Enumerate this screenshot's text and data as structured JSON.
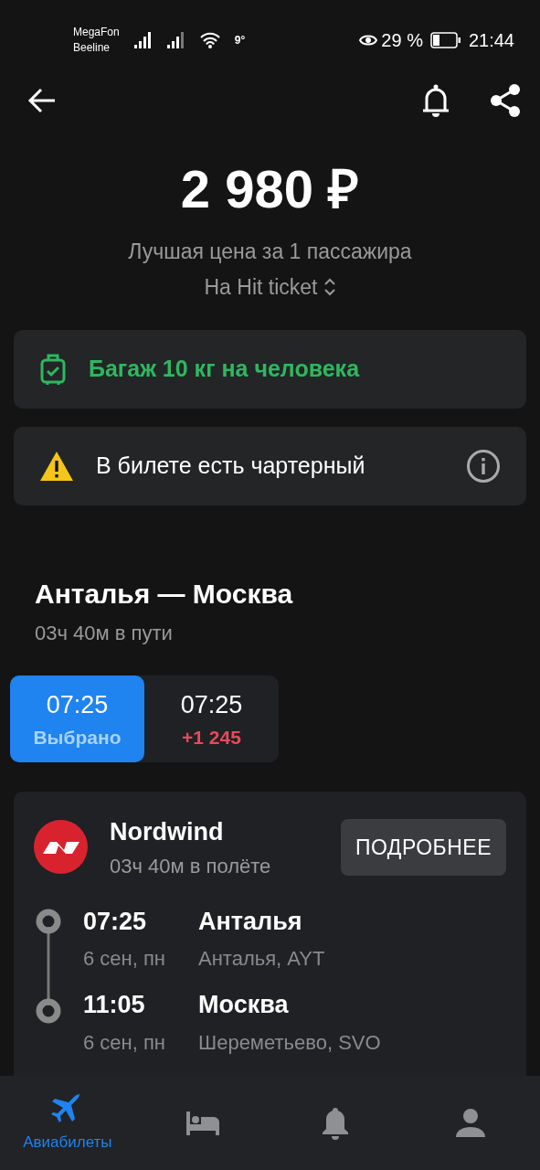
{
  "status_bar": {
    "carriers": [
      "MegaFon",
      "Beeline"
    ],
    "temperature": "9°",
    "battery_percent": "29 %",
    "time": "21:44"
  },
  "price": {
    "amount": "2 980 ₽",
    "subtitle": "Лучшая цена за 1 пассажира",
    "source": "На Hit ticket"
  },
  "notices": [
    {
      "kind": "baggage",
      "text": "Багаж 10 кг на человека"
    },
    {
      "kind": "warning",
      "text": "В билете есть чартерный"
    }
  ],
  "route": {
    "title": "Анталья — Москва",
    "duration": "03ч 40м в пути"
  },
  "departure_options": [
    {
      "time": "07:25",
      "note": "Выбрано",
      "selected": true
    },
    {
      "time": "07:25",
      "note": "+1 245",
      "selected": false
    }
  ],
  "flight": {
    "airline": "Nordwind",
    "duration": "03ч 40м в полёте",
    "details_button": "ПОДРОБНЕЕ",
    "stops": [
      {
        "time": "07:25",
        "date": "6 сен, пн",
        "city": "Анталья",
        "airport": "Анталья, AYT"
      },
      {
        "time": "11:05",
        "date": "6 сен, пн",
        "city": "Москва",
        "airport": "Шереметьево, SVO"
      }
    ]
  },
  "bottom_nav": [
    {
      "kind": "plane",
      "label": "Авиабилеты",
      "selected": true
    },
    {
      "kind": "bed",
      "selected": false
    },
    {
      "kind": "bell",
      "selected": false
    },
    {
      "kind": "person",
      "selected": false
    }
  ]
}
